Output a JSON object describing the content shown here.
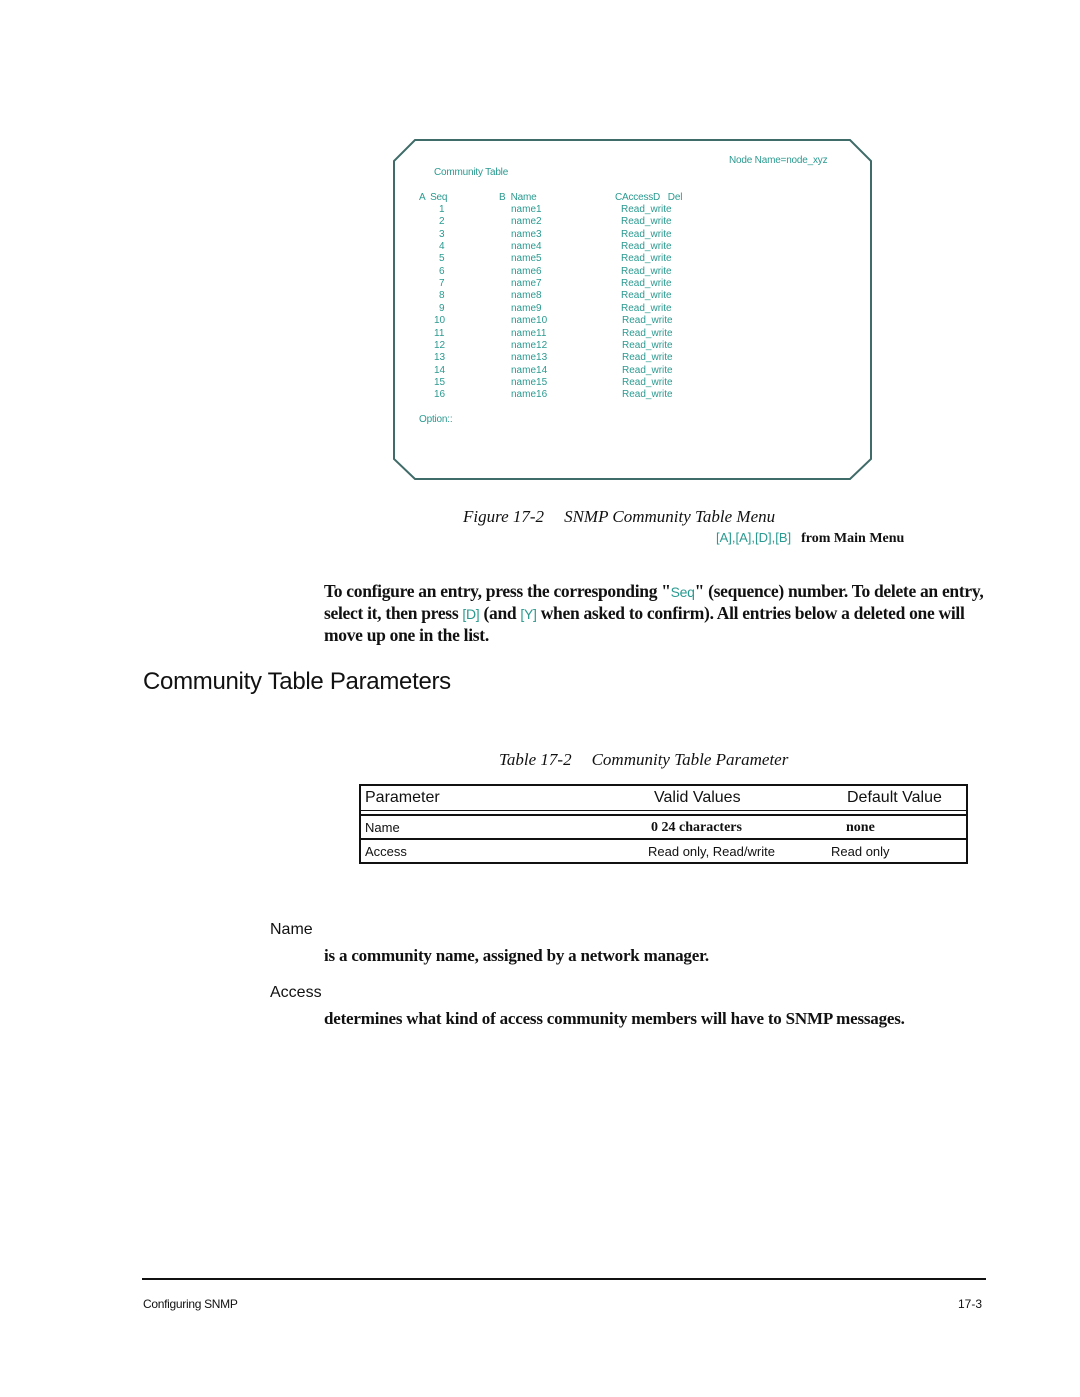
{
  "figure": {
    "screen": {
      "node_name": "Node Name=node_xyz",
      "title": "Community Table",
      "columns": [
        {
          "key": "A",
          "label": "Seq"
        },
        {
          "key": "B",
          "label": "Name"
        },
        {
          "key": "C",
          "label": "Access"
        },
        {
          "key": "D",
          "label": "Del"
        }
      ],
      "column_header_text": {
        "a": "A  Seq",
        "b": "B  Name",
        "c": "CAccessD   Del"
      },
      "rows": [
        {
          "seq": "1",
          "name": "name1",
          "access": "Read_write"
        },
        {
          "seq": "2",
          "name": "name2",
          "access": "Read_write"
        },
        {
          "seq": "3",
          "name": "name3",
          "access": "Read_write"
        },
        {
          "seq": "4",
          "name": "name4",
          "access": "Read_write"
        },
        {
          "seq": "5",
          "name": "name5",
          "access": "Read_write"
        },
        {
          "seq": "6",
          "name": "name6",
          "access": "Read_write"
        },
        {
          "seq": "7",
          "name": "name7",
          "access": "Read_write"
        },
        {
          "seq": "8",
          "name": "name8",
          "access": "Read_write"
        },
        {
          "seq": "9",
          "name": "name9",
          "access": "Read_write"
        },
        {
          "seq": "10",
          "name": "name10",
          "access": "Read_write"
        },
        {
          "seq": "11",
          "name": "name11",
          "access": "Read_write"
        },
        {
          "seq": "12",
          "name": "name12",
          "access": "Read_write"
        },
        {
          "seq": "13",
          "name": "name13",
          "access": "Read_write"
        },
        {
          "seq": "14",
          "name": "name14",
          "access": "Read_write"
        },
        {
          "seq": "15",
          "name": "name15",
          "access": "Read_write"
        },
        {
          "seq": "16",
          "name": "name16",
          "access": "Read_write"
        }
      ],
      "prompt": "Option::"
    },
    "caption_number": "Figure 17-2",
    "caption_title": "SNMP Community Table Menu",
    "menu_path_keys": "[A],[A],[D],[B]",
    "menu_path_suffix": "from Main Menu"
  },
  "paragraph": {
    "part1": "To configure an entry, press the corresponding \"",
    "key_seq": "Seq",
    "part2": "\" (sequence) number. To delete an entry, select it, then press ",
    "key_d": "[D]",
    "part3": " (and ",
    "key_y": "[Y]",
    "part4": " when asked to confirm). All entries below a deleted one will move up one in the list."
  },
  "section": {
    "title": "Community Table Parameters"
  },
  "table": {
    "caption_number": "Table 17-2",
    "caption_title": "Community Table Parameter",
    "headers": [
      "Parameter",
      "Valid Values",
      "Default Value"
    ],
    "rows": [
      {
        "parameter": "Name",
        "valid": "0 24 characters",
        "default": "none"
      },
      {
        "parameter": "Access",
        "valid": "Read only, Read/write",
        "default": "Read only"
      }
    ]
  },
  "definitions": [
    {
      "term": "Name",
      "body": "is a community name, assigned by a network manager."
    },
    {
      "term": "Access",
      "body": "determines what kind of access community members will have to SNMP messages."
    }
  ],
  "footer": {
    "left": "Configuring SNMP",
    "right": "17-3"
  },
  "colors": {
    "accent": "#2a9a90",
    "text": "#111111",
    "screen_border": "#3f6b68"
  }
}
